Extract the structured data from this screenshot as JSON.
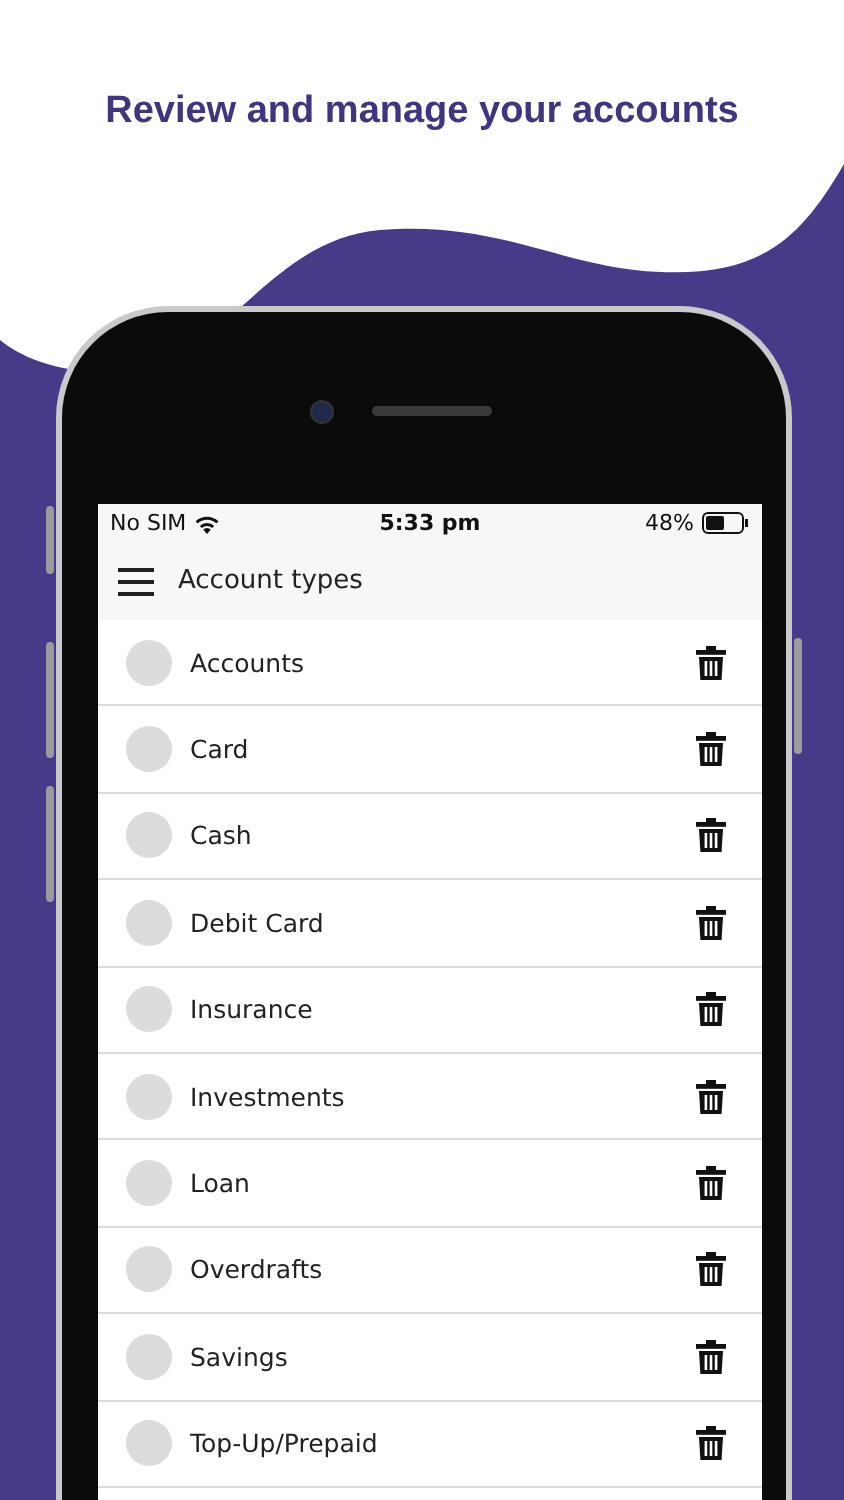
{
  "headline": "Review and manage your accounts",
  "status_bar": {
    "carrier": "No SIM",
    "time": "5:33 pm",
    "battery": "48%"
  },
  "app_bar": {
    "title": "Account types"
  },
  "items": [
    {
      "name": "Accounts"
    },
    {
      "name": "Card"
    },
    {
      "name": "Cash"
    },
    {
      "name": "Debit Card"
    },
    {
      "name": "Insurance"
    },
    {
      "name": "Investments"
    },
    {
      "name": "Loan"
    },
    {
      "name": "Overdrafts"
    },
    {
      "name": "Savings"
    },
    {
      "name": "Top-Up/Prepaid"
    }
  ]
}
